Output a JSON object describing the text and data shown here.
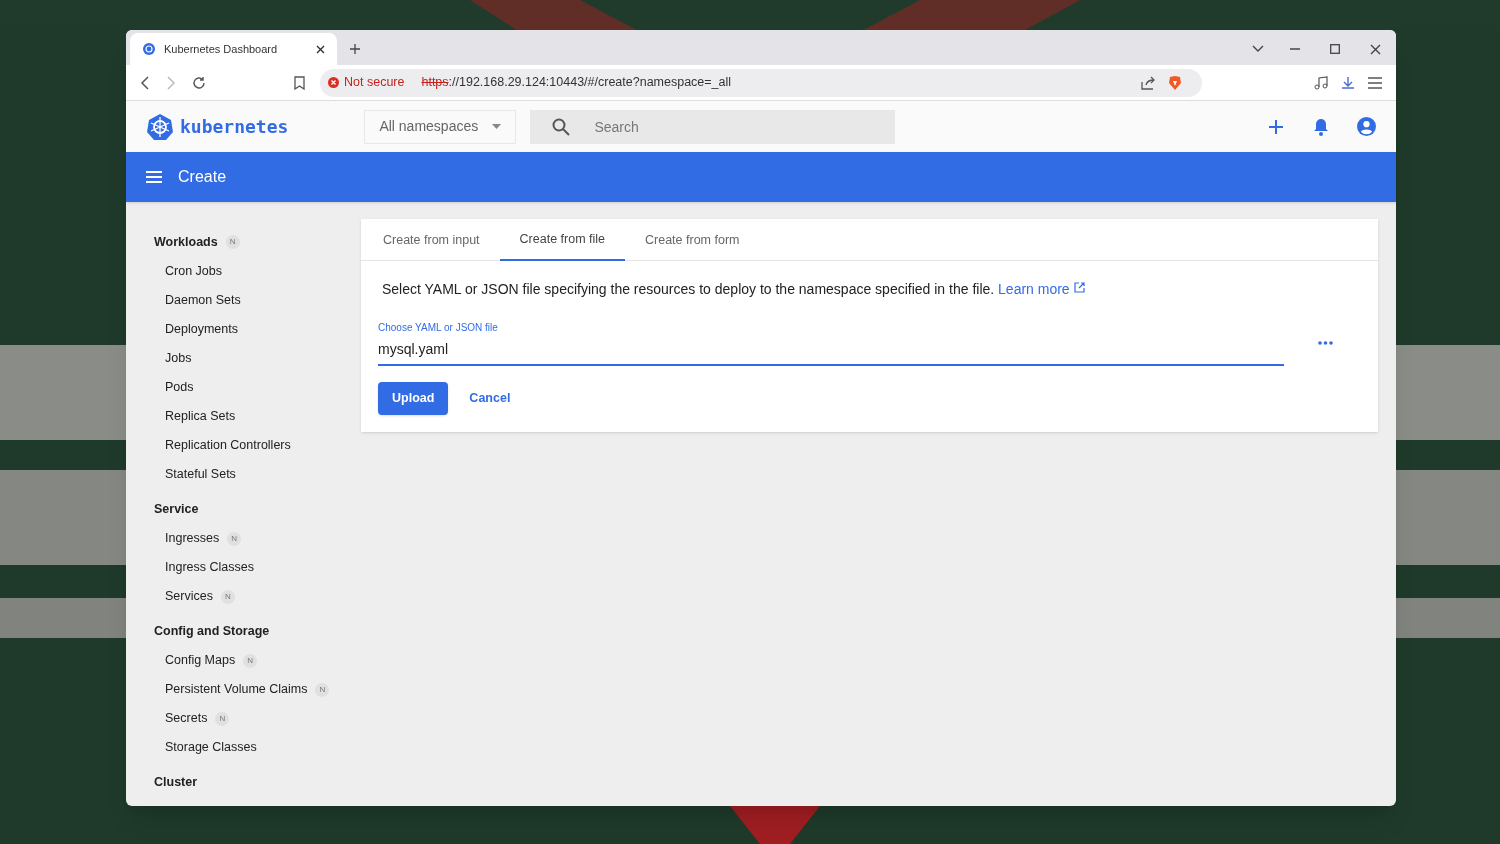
{
  "browser": {
    "tab": {
      "title": "Kubernetes Dashboard"
    },
    "security": "Not secure",
    "url_scheme": "https",
    "url_rest": "://192.168.29.124:10443/#/create?namespace=_all"
  },
  "header": {
    "logo": "kubernetes",
    "namespace": "All namespaces",
    "search": {
      "placeholder": "Search"
    }
  },
  "toolbar": {
    "title": "Create"
  },
  "sidebar": [
    {
      "title": "Workloads",
      "badge": "N",
      "items": [
        {
          "label": "Cron Jobs"
        },
        {
          "label": "Daemon Sets"
        },
        {
          "label": "Deployments"
        },
        {
          "label": "Jobs"
        },
        {
          "label": "Pods"
        },
        {
          "label": "Replica Sets"
        },
        {
          "label": "Replication Controllers"
        },
        {
          "label": "Stateful Sets"
        }
      ]
    },
    {
      "title": "Service",
      "items": [
        {
          "label": "Ingresses",
          "badge": "N"
        },
        {
          "label": "Ingress Classes"
        },
        {
          "label": "Services",
          "badge": "N"
        }
      ]
    },
    {
      "title": "Config and Storage",
      "items": [
        {
          "label": "Config Maps",
          "badge": "N"
        },
        {
          "label": "Persistent Volume Claims",
          "badge": "N"
        },
        {
          "label": "Secrets",
          "badge": "N"
        },
        {
          "label": "Storage Classes"
        }
      ]
    },
    {
      "title": "Cluster"
    }
  ],
  "tabs": [
    {
      "label": "Create from input",
      "selected": false
    },
    {
      "label": "Create from file",
      "selected": true
    },
    {
      "label": "Create from form",
      "selected": false
    }
  ],
  "description": "Select YAML or JSON file specifying the resources to deploy to the namespace specified in the file.",
  "learn_more": "Learn more",
  "file_field": {
    "label": "Choose YAML or JSON file",
    "value": "mysql.yaml"
  },
  "buttons": {
    "upload": "Upload",
    "cancel": "Cancel"
  }
}
